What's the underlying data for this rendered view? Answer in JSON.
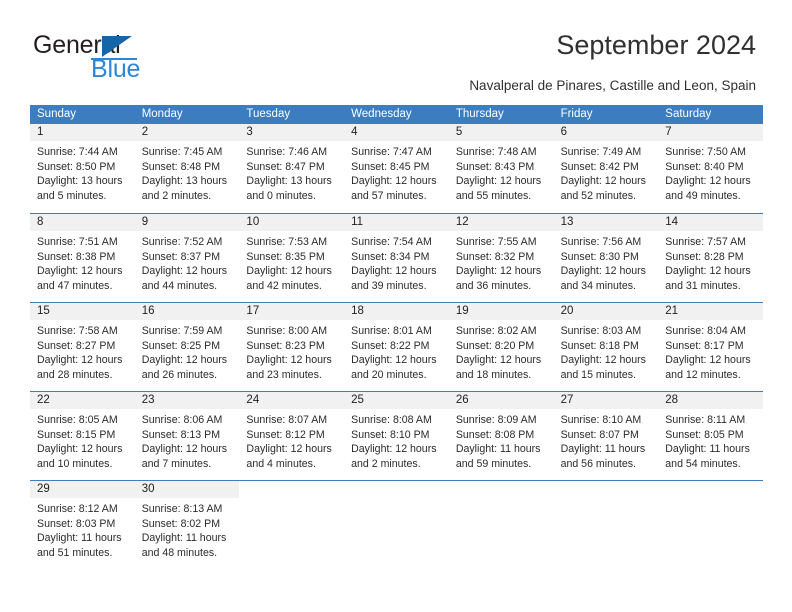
{
  "brand": {
    "name_part1": "General",
    "name_part2": "Blue"
  },
  "header": {
    "title": "September 2024",
    "subtitle": "Navalperal de Pinares, Castille and Leon, Spain"
  },
  "colors": {
    "header_blue": "#3b7dbf",
    "date_band": "#f1f1f1",
    "logo_triangle": "#1565a8",
    "logo_blue_text": "#2e87d6"
  },
  "calendar": {
    "weekdays": [
      "Sunday",
      "Monday",
      "Tuesday",
      "Wednesday",
      "Thursday",
      "Friday",
      "Saturday"
    ],
    "weeks": [
      [
        {
          "date": "1",
          "sunrise": "Sunrise: 7:44 AM",
          "sunset": "Sunset: 8:50 PM",
          "daylight1": "Daylight: 13 hours",
          "daylight2": "and 5 minutes."
        },
        {
          "date": "2",
          "sunrise": "Sunrise: 7:45 AM",
          "sunset": "Sunset: 8:48 PM",
          "daylight1": "Daylight: 13 hours",
          "daylight2": "and 2 minutes."
        },
        {
          "date": "3",
          "sunrise": "Sunrise: 7:46 AM",
          "sunset": "Sunset: 8:47 PM",
          "daylight1": "Daylight: 13 hours",
          "daylight2": "and 0 minutes."
        },
        {
          "date": "4",
          "sunrise": "Sunrise: 7:47 AM",
          "sunset": "Sunset: 8:45 PM",
          "daylight1": "Daylight: 12 hours",
          "daylight2": "and 57 minutes."
        },
        {
          "date": "5",
          "sunrise": "Sunrise: 7:48 AM",
          "sunset": "Sunset: 8:43 PM",
          "daylight1": "Daylight: 12 hours",
          "daylight2": "and 55 minutes."
        },
        {
          "date": "6",
          "sunrise": "Sunrise: 7:49 AM",
          "sunset": "Sunset: 8:42 PM",
          "daylight1": "Daylight: 12 hours",
          "daylight2": "and 52 minutes."
        },
        {
          "date": "7",
          "sunrise": "Sunrise: 7:50 AM",
          "sunset": "Sunset: 8:40 PM",
          "daylight1": "Daylight: 12 hours",
          "daylight2": "and 49 minutes."
        }
      ],
      [
        {
          "date": "8",
          "sunrise": "Sunrise: 7:51 AM",
          "sunset": "Sunset: 8:38 PM",
          "daylight1": "Daylight: 12 hours",
          "daylight2": "and 47 minutes."
        },
        {
          "date": "9",
          "sunrise": "Sunrise: 7:52 AM",
          "sunset": "Sunset: 8:37 PM",
          "daylight1": "Daylight: 12 hours",
          "daylight2": "and 44 minutes."
        },
        {
          "date": "10",
          "sunrise": "Sunrise: 7:53 AM",
          "sunset": "Sunset: 8:35 PM",
          "daylight1": "Daylight: 12 hours",
          "daylight2": "and 42 minutes."
        },
        {
          "date": "11",
          "sunrise": "Sunrise: 7:54 AM",
          "sunset": "Sunset: 8:34 PM",
          "daylight1": "Daylight: 12 hours",
          "daylight2": "and 39 minutes."
        },
        {
          "date": "12",
          "sunrise": "Sunrise: 7:55 AM",
          "sunset": "Sunset: 8:32 PM",
          "daylight1": "Daylight: 12 hours",
          "daylight2": "and 36 minutes."
        },
        {
          "date": "13",
          "sunrise": "Sunrise: 7:56 AM",
          "sunset": "Sunset: 8:30 PM",
          "daylight1": "Daylight: 12 hours",
          "daylight2": "and 34 minutes."
        },
        {
          "date": "14",
          "sunrise": "Sunrise: 7:57 AM",
          "sunset": "Sunset: 8:28 PM",
          "daylight1": "Daylight: 12 hours",
          "daylight2": "and 31 minutes."
        }
      ],
      [
        {
          "date": "15",
          "sunrise": "Sunrise: 7:58 AM",
          "sunset": "Sunset: 8:27 PM",
          "daylight1": "Daylight: 12 hours",
          "daylight2": "and 28 minutes."
        },
        {
          "date": "16",
          "sunrise": "Sunrise: 7:59 AM",
          "sunset": "Sunset: 8:25 PM",
          "daylight1": "Daylight: 12 hours",
          "daylight2": "and 26 minutes."
        },
        {
          "date": "17",
          "sunrise": "Sunrise: 8:00 AM",
          "sunset": "Sunset: 8:23 PM",
          "daylight1": "Daylight: 12 hours",
          "daylight2": "and 23 minutes."
        },
        {
          "date": "18",
          "sunrise": "Sunrise: 8:01 AM",
          "sunset": "Sunset: 8:22 PM",
          "daylight1": "Daylight: 12 hours",
          "daylight2": "and 20 minutes."
        },
        {
          "date": "19",
          "sunrise": "Sunrise: 8:02 AM",
          "sunset": "Sunset: 8:20 PM",
          "daylight1": "Daylight: 12 hours",
          "daylight2": "and 18 minutes."
        },
        {
          "date": "20",
          "sunrise": "Sunrise: 8:03 AM",
          "sunset": "Sunset: 8:18 PM",
          "daylight1": "Daylight: 12 hours",
          "daylight2": "and 15 minutes."
        },
        {
          "date": "21",
          "sunrise": "Sunrise: 8:04 AM",
          "sunset": "Sunset: 8:17 PM",
          "daylight1": "Daylight: 12 hours",
          "daylight2": "and 12 minutes."
        }
      ],
      [
        {
          "date": "22",
          "sunrise": "Sunrise: 8:05 AM",
          "sunset": "Sunset: 8:15 PM",
          "daylight1": "Daylight: 12 hours",
          "daylight2": "and 10 minutes."
        },
        {
          "date": "23",
          "sunrise": "Sunrise: 8:06 AM",
          "sunset": "Sunset: 8:13 PM",
          "daylight1": "Daylight: 12 hours",
          "daylight2": "and 7 minutes."
        },
        {
          "date": "24",
          "sunrise": "Sunrise: 8:07 AM",
          "sunset": "Sunset: 8:12 PM",
          "daylight1": "Daylight: 12 hours",
          "daylight2": "and 4 minutes."
        },
        {
          "date": "25",
          "sunrise": "Sunrise: 8:08 AM",
          "sunset": "Sunset: 8:10 PM",
          "daylight1": "Daylight: 12 hours",
          "daylight2": "and 2 minutes."
        },
        {
          "date": "26",
          "sunrise": "Sunrise: 8:09 AM",
          "sunset": "Sunset: 8:08 PM",
          "daylight1": "Daylight: 11 hours",
          "daylight2": "and 59 minutes."
        },
        {
          "date": "27",
          "sunrise": "Sunrise: 8:10 AM",
          "sunset": "Sunset: 8:07 PM",
          "daylight1": "Daylight: 11 hours",
          "daylight2": "and 56 minutes."
        },
        {
          "date": "28",
          "sunrise": "Sunrise: 8:11 AM",
          "sunset": "Sunset: 8:05 PM",
          "daylight1": "Daylight: 11 hours",
          "daylight2": "and 54 minutes."
        }
      ],
      [
        {
          "date": "29",
          "sunrise": "Sunrise: 8:12 AM",
          "sunset": "Sunset: 8:03 PM",
          "daylight1": "Daylight: 11 hours",
          "daylight2": "and 51 minutes."
        },
        {
          "date": "30",
          "sunrise": "Sunrise: 8:13 AM",
          "sunset": "Sunset: 8:02 PM",
          "daylight1": "Daylight: 11 hours",
          "daylight2": "and 48 minutes."
        },
        {
          "date": "",
          "sunrise": "",
          "sunset": "",
          "daylight1": "",
          "daylight2": ""
        },
        {
          "date": "",
          "sunrise": "",
          "sunset": "",
          "daylight1": "",
          "daylight2": ""
        },
        {
          "date": "",
          "sunrise": "",
          "sunset": "",
          "daylight1": "",
          "daylight2": ""
        },
        {
          "date": "",
          "sunrise": "",
          "sunset": "",
          "daylight1": "",
          "daylight2": ""
        },
        {
          "date": "",
          "sunrise": "",
          "sunset": "",
          "daylight1": "",
          "daylight2": ""
        }
      ]
    ]
  }
}
